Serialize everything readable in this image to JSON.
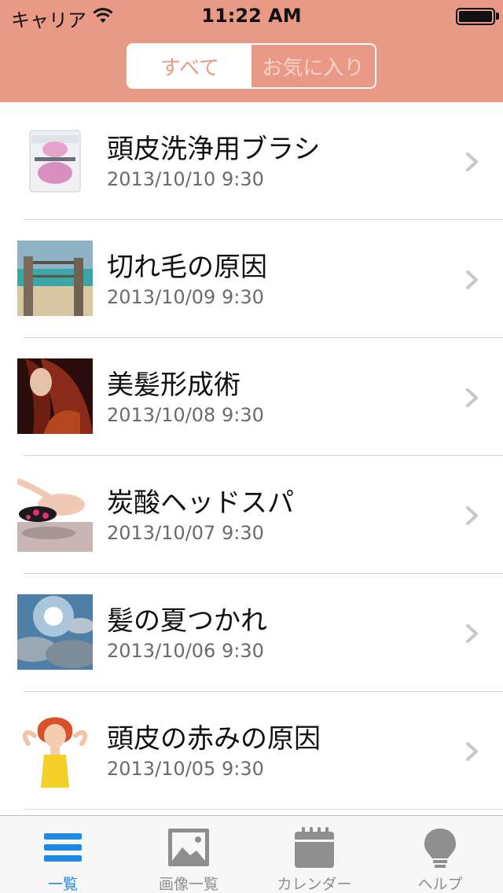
{
  "status_bar": {
    "carrier": "キャリア",
    "time": "11:22 AM"
  },
  "segmented": {
    "all_label": "すべて",
    "favorites_label": "お気に入り",
    "selected": "すべて"
  },
  "items": [
    {
      "title": "頭皮洗浄用ブラシ",
      "date": "2013/10/10 9:30",
      "thumb": "brush-package-thumbnail"
    },
    {
      "title": "切れ毛の原因",
      "date": "2013/10/09 9:30",
      "thumb": "beach-thumbnail"
    },
    {
      "title": "美髪形成術",
      "date": "2013/10/08 9:30",
      "thumb": "woman-long-hair-thumbnail"
    },
    {
      "title": "炭酸ヘッドスパ",
      "date": "2013/10/07 9:30",
      "thumb": "head-spa-thumbnail"
    },
    {
      "title": "髪の夏つかれ",
      "date": "2013/10/06 9:30",
      "thumb": "sunny-sky-thumbnail"
    },
    {
      "title": "頭皮の赤みの原因",
      "date": "2013/10/05 9:30",
      "thumb": "cartoon-woman-thumbnail"
    }
  ],
  "tabs": [
    {
      "label": "一覧",
      "icon": "list-icon",
      "active": true
    },
    {
      "label": "画像一覧",
      "icon": "image-gallery-icon",
      "active": false
    },
    {
      "label": "カレンダー",
      "icon": "calendar-icon",
      "active": false
    },
    {
      "label": "ヘルプ",
      "icon": "lightbulb-icon",
      "active": false
    }
  ],
  "colors": {
    "header": "#E89A86",
    "accent": "#1E88E5",
    "inactive": "#8e8e8e"
  }
}
